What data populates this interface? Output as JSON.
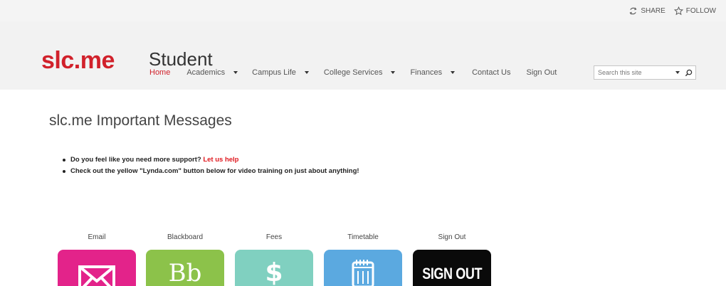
{
  "top_actions": {
    "share_label": "SHARE",
    "follow_label": "FOLLOW"
  },
  "header": {
    "logo_text": "slc.me",
    "site_title": "Student"
  },
  "nav": {
    "items": [
      {
        "label": "Home",
        "active": true
      },
      {
        "label": "Academics",
        "dropdown": true
      },
      {
        "label": "Campus Life",
        "dropdown": true
      },
      {
        "label": "College Services",
        "dropdown": true
      },
      {
        "label": "Finances",
        "dropdown": true
      },
      {
        "label": "Contact Us"
      },
      {
        "label": "Sign Out"
      }
    ]
  },
  "search": {
    "placeholder": "Search this site"
  },
  "main": {
    "title": "slc.me Important Messages",
    "messages": [
      {
        "text": "Do you feel like you need more support? ",
        "link": "Let us help"
      },
      {
        "text": "Check out the yellow \"Lynda.com\" button below for video training on just about anything!"
      }
    ]
  },
  "tiles": [
    {
      "label": "Email",
      "icon": "envelope-icon",
      "color": "#e3238a"
    },
    {
      "label": "Blackboard",
      "icon": "blackboard-icon",
      "icon_text": "Bb",
      "color": "#8cc24a"
    },
    {
      "label": "Fees",
      "icon": "dollar-icon",
      "icon_text": "$",
      "color": "#80d0c0"
    },
    {
      "label": "Timetable",
      "icon": "calendar-icon",
      "color": "#5ba9e0"
    },
    {
      "label": "Sign Out",
      "icon": "sign-out-icon",
      "icon_text": "SIGN OUT",
      "color": "#0a0a0a"
    }
  ],
  "colors": {
    "brand": "#d1212b",
    "link": "#e0191f",
    "header_bg": "#f2f2f2"
  }
}
